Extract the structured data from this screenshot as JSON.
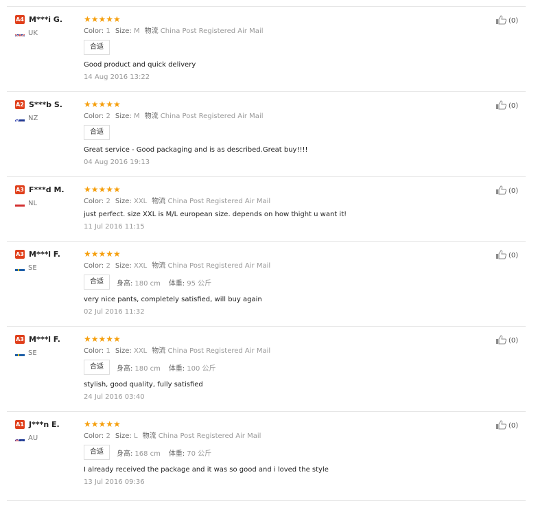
{
  "reviews": [
    {
      "level": "A4",
      "name": "M***i G.",
      "country": "UK",
      "flag": "uk",
      "stars": "★★★★★",
      "color_label": "Color:",
      "color": "1",
      "size_label": "Size:",
      "size": "M",
      "ship_label": "物流",
      "shipping": "China Post Registered Air Mail",
      "fit_tag": "合适",
      "height_label": "",
      "height": "",
      "weight_label": "",
      "weight": "",
      "feedback": "Good product and quick delivery",
      "date": "14 Aug 2016 13:22",
      "likes": "(0)"
    },
    {
      "level": "A2",
      "name": "S***b S.",
      "country": "NZ",
      "flag": "nz",
      "stars": "★★★★★",
      "color_label": "Color:",
      "color": "2",
      "size_label": "Size:",
      "size": "M",
      "ship_label": "物流",
      "shipping": "China Post Registered Air Mail",
      "fit_tag": "合适",
      "height_label": "",
      "height": "",
      "weight_label": "",
      "weight": "",
      "feedback": "Great service - Good packaging and is as described.Great buy!!!!",
      "date": "04 Aug 2016 19:13",
      "likes": "(0)"
    },
    {
      "level": "A3",
      "name": "F***d M.",
      "country": "NL",
      "flag": "nl",
      "stars": "★★★★★",
      "color_label": "Color:",
      "color": "2",
      "size_label": "Size:",
      "size": "XXL",
      "ship_label": "物流",
      "shipping": "China Post Registered Air Mail",
      "fit_tag": "",
      "height_label": "",
      "height": "",
      "weight_label": "",
      "weight": "",
      "feedback": "just perfect. size XXL is M/L european size. depends on how thight u want it!",
      "date": "11 Jul 2016 11:15",
      "likes": "(0)"
    },
    {
      "level": "A3",
      "name": "M***l F.",
      "country": "SE",
      "flag": "se",
      "stars": "★★★★★",
      "color_label": "Color:",
      "color": "2",
      "size_label": "Size:",
      "size": "XXL",
      "ship_label": "物流",
      "shipping": "China Post Registered Air Mail",
      "fit_tag": "合适",
      "height_label": "身高:",
      "height": "180 cm",
      "weight_label": "体重:",
      "weight": "95 公斤",
      "feedback": "very nice pants, completely satisfied, will buy again",
      "date": "02 Jul 2016 11:32",
      "likes": "(0)"
    },
    {
      "level": "A3",
      "name": "M***l F.",
      "country": "SE",
      "flag": "se",
      "stars": "★★★★★",
      "color_label": "Color:",
      "color": "1",
      "size_label": "Size:",
      "size": "XXL",
      "ship_label": "物流",
      "shipping": "China Post Registered Air Mail",
      "fit_tag": "合适",
      "height_label": "身高:",
      "height": "180 cm",
      "weight_label": "体重:",
      "weight": "100 公斤",
      "feedback": "stylish, good quality, fully satisfied",
      "date": "24 Jul 2016 03:40",
      "likes": "(0)"
    },
    {
      "level": "A1",
      "name": "J***n E.",
      "country": "AU",
      "flag": "au",
      "stars": "★★★★★",
      "color_label": "Color:",
      "color": "2",
      "size_label": "Size:",
      "size": "L",
      "ship_label": "物流",
      "shipping": "China Post Registered Air Mail",
      "fit_tag": "合适",
      "height_label": "身高:",
      "height": "168 cm",
      "weight_label": "体重:",
      "weight": "70 公斤",
      "feedback": "I already received the package and it was so good and i loved the style",
      "date": "13 Jul 2016 09:36",
      "likes": "(0)"
    }
  ]
}
